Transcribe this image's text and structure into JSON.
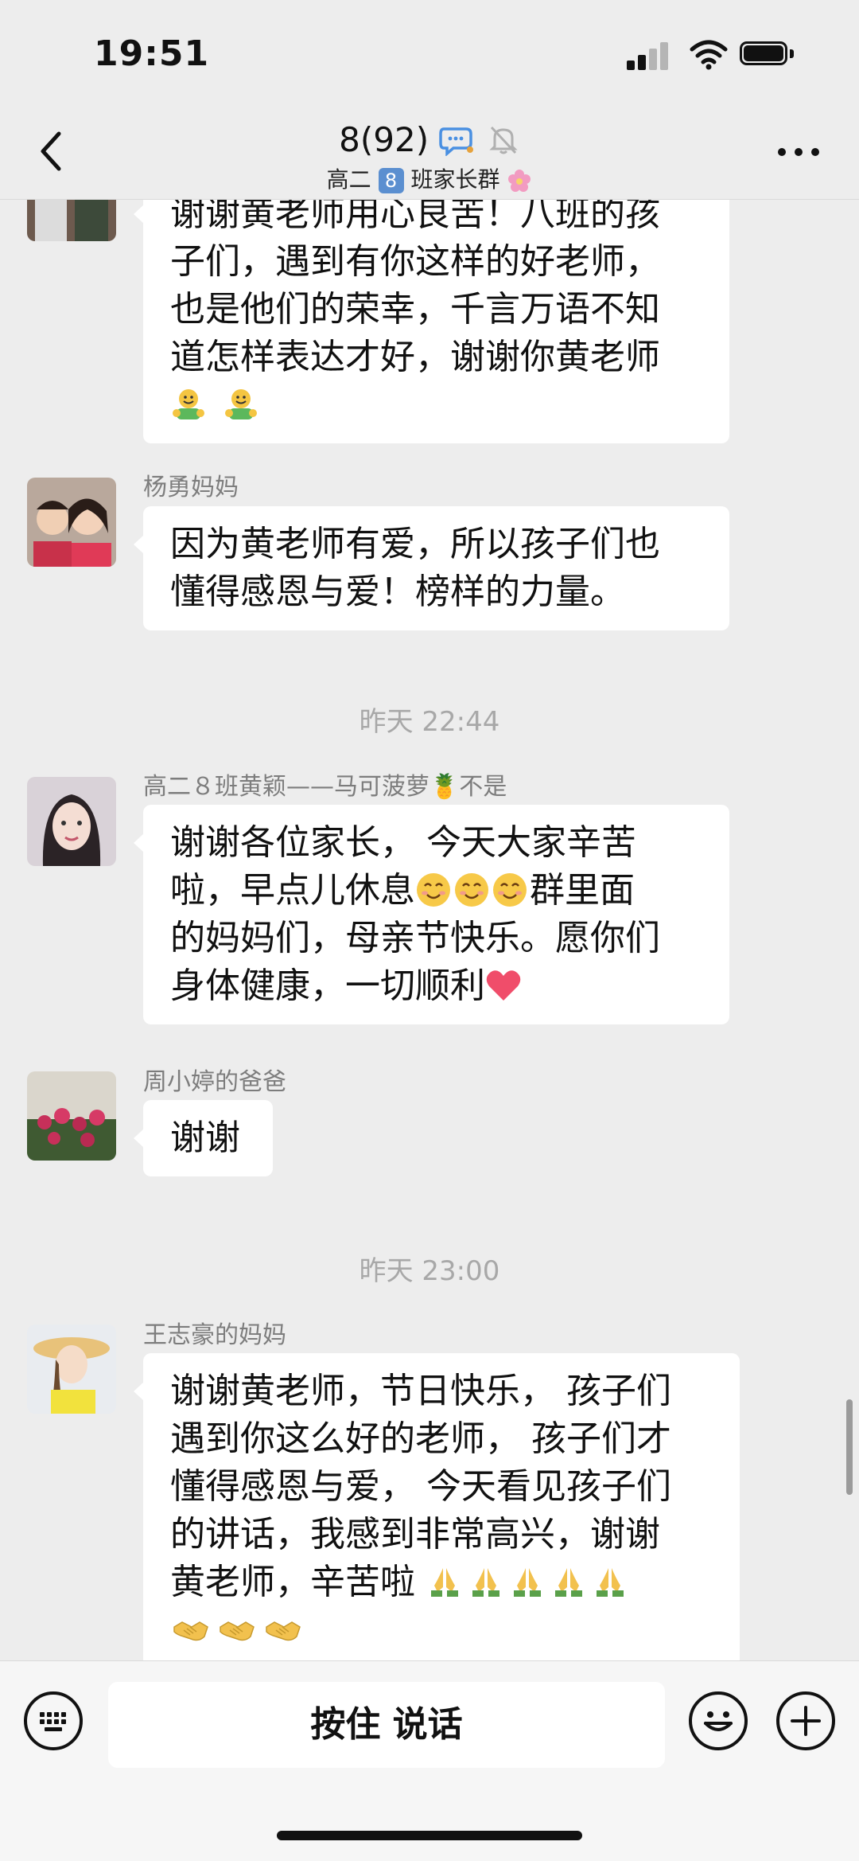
{
  "status_bar": {
    "time": "19:51"
  },
  "nav": {
    "title": "8(92)",
    "subtitle_prefix": "高二",
    "subtitle_badge": "8",
    "subtitle_suffix": "班家长群"
  },
  "messages": [
    {
      "sender": "",
      "lines": [
        "谢谢黄老师用心良苦！八班的孩",
        "子们，遇到有你这样的好老师，",
        "也是他们的荣幸，千言万语不知",
        "道怎样表达才好，谢谢你黄老师"
      ],
      "emojis": [
        "hug-emoji",
        "hug-emoji"
      ]
    },
    {
      "sender": "杨勇妈妈",
      "lines": [
        "因为黄老师有爱，所以孩子们也",
        "懂得感恩与爱！榜样的力量。"
      ]
    },
    {
      "time_separator": "昨天 22:44"
    },
    {
      "sender": "高二８班黄颖——马可菠萝🍍不是",
      "lines": [
        "谢谢各位家长， 今天大家辛苦",
        "的妈妈们，母亲节快乐。愿你们",
        "身体健康，一切顺利"
      ],
      "line2_prefix": "啦，早点儿休息",
      "line2_suffix": "群里面"
    },
    {
      "sender": "周小婷的爸爸",
      "lines": [
        "谢谢"
      ]
    },
    {
      "time_separator": "昨天 23:00"
    },
    {
      "sender": "王志豪的妈妈",
      "lines": [
        "谢谢黄老师，节日快乐， 孩子们",
        "遇到你这么好的老师， 孩子们才",
        "懂得感恩与爱， 今天看见孩子们",
        "的讲话，我感到非常高兴，谢谢",
        "黄老师，辛苦啦 "
      ]
    }
  ],
  "input_bar": {
    "hold_talk_label": "按住 说话"
  },
  "colors": {
    "background": "#ededed",
    "bubble": "#ffffff",
    "accent_blue": "#5b8fd0"
  }
}
